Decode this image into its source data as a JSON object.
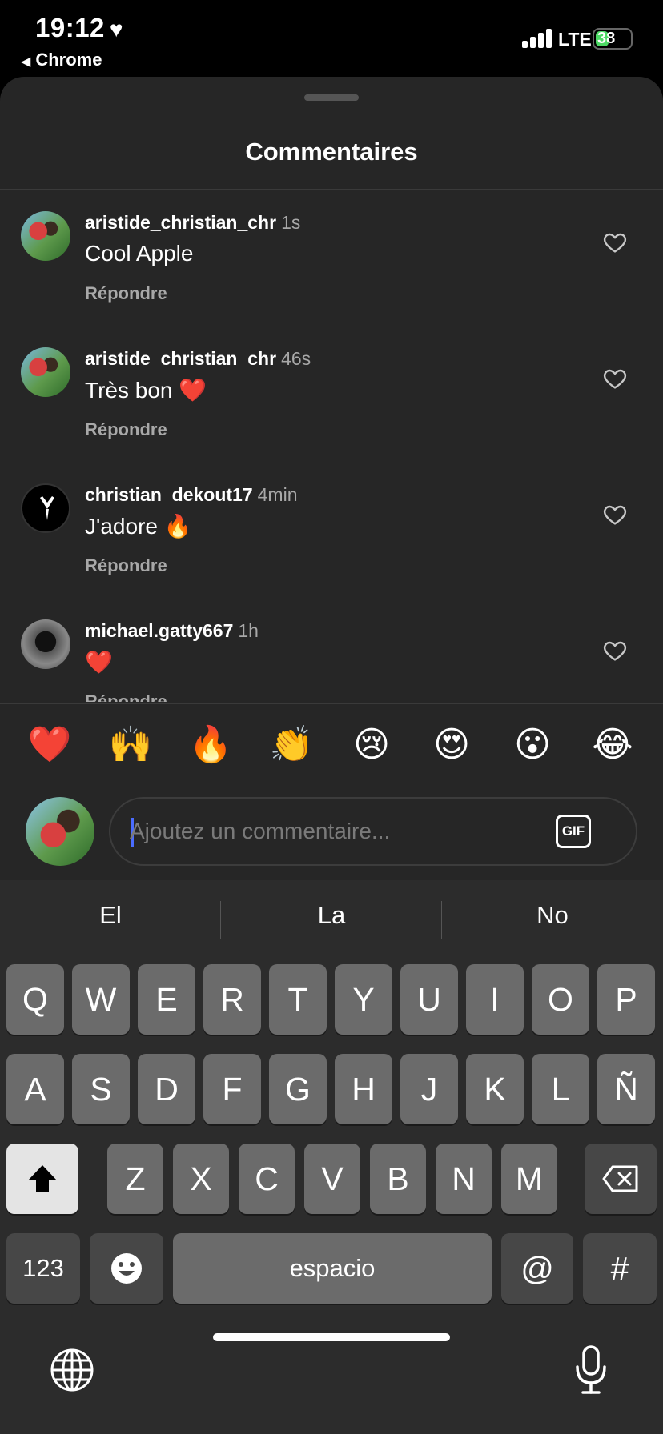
{
  "status_bar": {
    "time": "19:12",
    "heart": "♥",
    "back_app": "Chrome",
    "network": "LTE",
    "battery": "38",
    "battery_level_percent": 38,
    "battery_color": "#4cd964"
  },
  "sheet": {
    "title": "Commentaires"
  },
  "comments": [
    {
      "username": "aristide_christian_chr",
      "ago": "1s",
      "text": "Cool Apple",
      "reply": "Répondre",
      "avatar": "photo"
    },
    {
      "username": "aristide_christian_chr",
      "ago": "46s",
      "text": "Très bon ❤️",
      "reply": "Répondre",
      "avatar": "photo"
    },
    {
      "username": "christian_dekout17",
      "ago": "4min",
      "text": "J'adore 🔥",
      "reply": "Répondre",
      "avatar": "suit"
    },
    {
      "username": "michael.gatty667",
      "ago": "1h",
      "text": "❤️",
      "reply": "Répondre",
      "avatar": "hood"
    }
  ],
  "emoji_bar": [
    "❤️",
    "🙌",
    "🔥",
    "👏",
    "😢",
    "😍",
    "😮",
    "😂"
  ],
  "composer": {
    "placeholder": "Ajoutez un commentaire...",
    "gif_label": "GIF"
  },
  "keyboard": {
    "suggestions": [
      "El",
      "La",
      "No"
    ],
    "row1": [
      "Q",
      "W",
      "E",
      "R",
      "T",
      "Y",
      "U",
      "I",
      "O",
      "P"
    ],
    "row2": [
      "A",
      "S",
      "D",
      "F",
      "G",
      "H",
      "J",
      "K",
      "L",
      "Ñ"
    ],
    "row3": [
      "Z",
      "X",
      "C",
      "V",
      "B",
      "N",
      "M"
    ],
    "numbers_label": "123",
    "space_label": "espacio",
    "at_label": "@",
    "hash_label": "#"
  }
}
